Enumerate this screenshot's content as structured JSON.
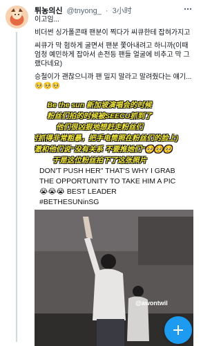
{
  "author": {
    "display_name": "튀농의신",
    "handle": "@tnyong_",
    "time": "3小时"
  },
  "tweet": {
    "lines": [
      "이고임...",
      "비더썬 싱가폴콘때 팬분이 찍다가 씨큐한테 잡혀가지고",
      "씨큐가 막 험하게 굴면서 팬분 쫓아내려고 하니까(이때 엄청 예민하게 잡아서 손전등 팬들 얼굴에 비추고 막 그랬다네요)",
      "승철이가 괜찮으니까 팬 밀지 말라고 말려줬다는 얘기... 🥺🥺🥺"
    ]
  },
  "media": {
    "captions": [
      "Be the sun 新加坡演唱会的时候",
      "粉丝们拍的时候被SEECU抓到了",
      "他们很凶狠地想赶走粉丝们",
      "(这时抓得非常粗暴，把手电筒照在粉丝们的脸上)",
      "胜澈和他们说“没有关系 不要推她们”🥺🥺🥺",
      "于是这位粉丝拍下了这张照片"
    ],
    "english_lines": [
      "DON'T PUSH HER\" THAT'S WHY I GRAB",
      "THE OPPORTUNITY TO TAKE HIM A PIC",
      "😭😭😭 BEST LEADER",
      "#BETHESUNinSG"
    ],
    "watermark": "@awontwil"
  },
  "icons": {
    "more": "more-options-icon",
    "compose": "compose-plus-icon"
  },
  "colors": {
    "accent": "#1d9bf0",
    "caption": "#f5ea3a"
  }
}
